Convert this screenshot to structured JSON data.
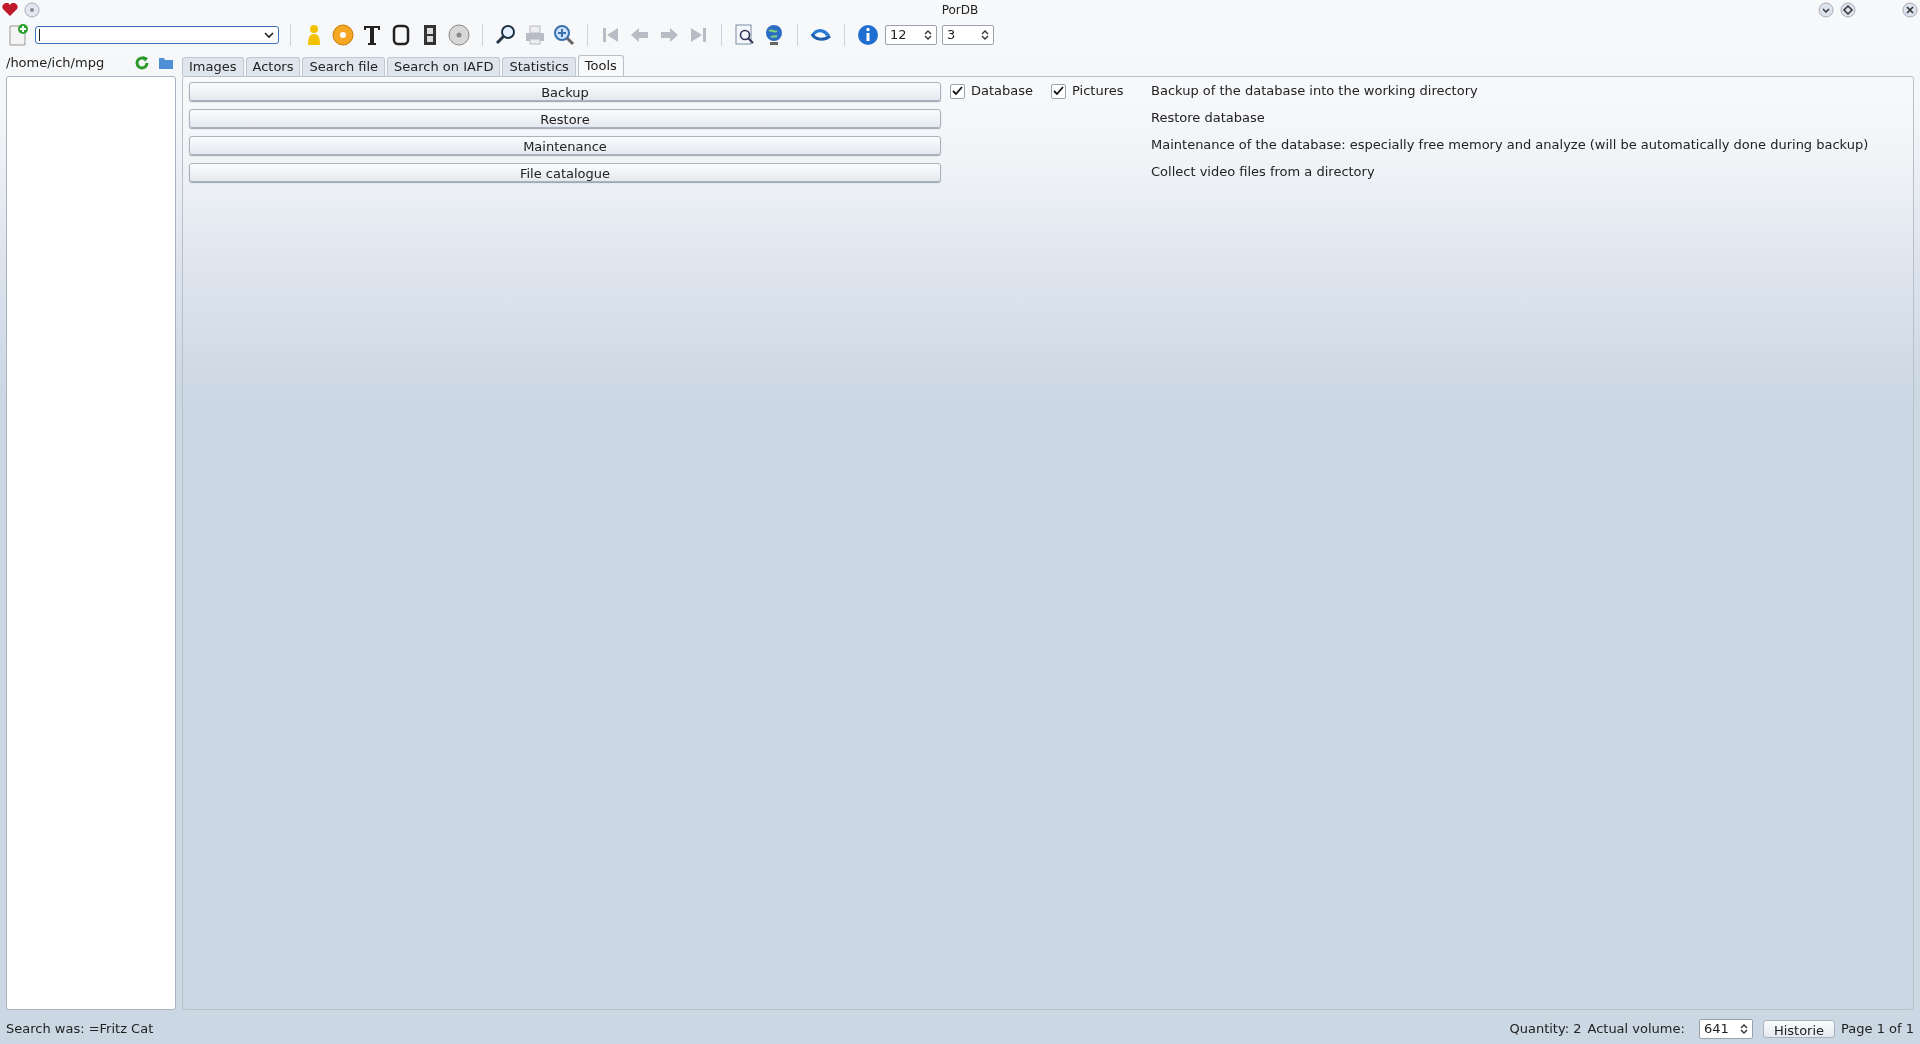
{
  "window": {
    "title": "PorDB"
  },
  "toolbar": {
    "buttons": [
      {
        "kind": "add",
        "disabled": false
      },
      {
        "kind": "combo"
      },
      {
        "kind": "actor",
        "disabled": false
      },
      {
        "kind": "disc",
        "disabled": false
      },
      {
        "kind": "text",
        "disabled": false
      },
      {
        "kind": "frame",
        "disabled": false
      },
      {
        "kind": "film",
        "disabled": false
      },
      {
        "kind": "dvd",
        "disabled": false
      },
      {
        "kind": "search",
        "disabled": false
      },
      {
        "kind": "print",
        "disabled": true
      },
      {
        "kind": "zoom",
        "disabled": false
      },
      {
        "kind": "first",
        "disabled": true
      },
      {
        "kind": "back",
        "disabled": true
      },
      {
        "kind": "forward",
        "disabled": true
      },
      {
        "kind": "last",
        "disabled": true
      },
      {
        "kind": "preview",
        "disabled": false
      },
      {
        "kind": "globe",
        "disabled": false
      },
      {
        "kind": "swap",
        "disabled": false
      },
      {
        "kind": "info",
        "disabled": false
      }
    ],
    "spinboxes": [
      {
        "value": "12"
      },
      {
        "value": "3"
      }
    ]
  },
  "sidebar": {
    "path": "/home/ich/mpg"
  },
  "tabs": [
    {
      "label": "Images",
      "selected": false
    },
    {
      "label": "Actors",
      "selected": false
    },
    {
      "label": "Search file",
      "selected": false
    },
    {
      "label": "Search on IAFD",
      "selected": false
    },
    {
      "label": "Statistics",
      "selected": false
    },
    {
      "label": "Tools",
      "selected": true
    }
  ],
  "tools": [
    {
      "button": "Backup",
      "options": [
        {
          "label": "Database",
          "checked": true
        },
        {
          "label": "Pictures",
          "checked": true
        }
      ],
      "description": "Backup of the database into the working directory"
    },
    {
      "button": "Restore",
      "description": "Restore database"
    },
    {
      "button": "Maintenance",
      "description": "Maintenance of the database: especially free memory and analyze (will be automatically done during backup)"
    },
    {
      "button": "File catalogue",
      "description": "Collect video files from a directory"
    }
  ],
  "status_bar": {
    "search": "Search was: =Fritz Cat",
    "quantity": "Quantity: 2",
    "volume_label": "Actual volume:",
    "volume": "641",
    "history_button": "Historie",
    "page": "Page 1 of 1"
  }
}
